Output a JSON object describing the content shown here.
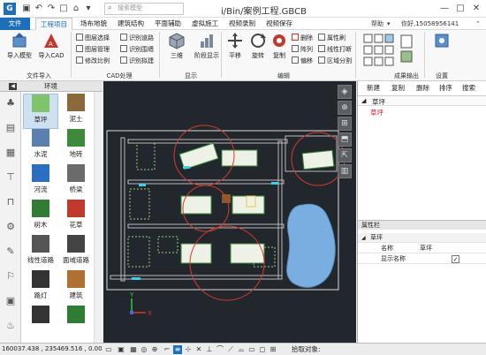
{
  "titlebar": {
    "search_placeholder": "搜索模型",
    "window_title": "i/Bin/案例工程.GBCB",
    "minimize": "—",
    "maximize": "□",
    "close": "✕"
  },
  "menu": {
    "tabs": [
      "文件",
      "工程项目",
      "场布地貌",
      "建筑结构",
      "平面辅助",
      "虚拟施工",
      "视频录制",
      "视频保存"
    ],
    "active_tab": "工程项目",
    "help": "帮助",
    "user": "你好,15058956141"
  },
  "ribbon": {
    "groups": {
      "file_import": "文件导入",
      "cad": "CAD处理",
      "display": "显示",
      "edit": "编辑",
      "output": "成果输出",
      "settings": "设置"
    },
    "import_model": "导入模型",
    "import_cad": "导入CAD",
    "cad_small": [
      "图层选择",
      "图层管理",
      "修改比例"
    ],
    "cad_small2": [
      "识别道路",
      "识别围墙",
      "识别拟建"
    ],
    "three_d": "三维",
    "stage_display": "阶段显示",
    "pan": "平移",
    "rotate": "旋转",
    "copy": "复制",
    "edit_small": [
      "删除",
      "阵列",
      "偏移"
    ],
    "edit_small2": [
      "属性刷",
      "线性打断",
      "区域分割"
    ],
    "accent": "#1e6fb9"
  },
  "leftpanel": {
    "title": "环境",
    "materials": [
      {
        "label": "草坪",
        "color": "#7fc46a"
      },
      {
        "label": "泥土",
        "color": "#8a6a3a"
      },
      {
        "label": "水泥",
        "color": "#5b7fae"
      },
      {
        "label": "地砖",
        "color": "#3c8a3a"
      },
      {
        "label": "河流",
        "color": "#2a6fc0"
      },
      {
        "label": "桥梁",
        "color": "#6b6b6b"
      },
      {
        "label": "树木",
        "color": "#2e7d32"
      },
      {
        "label": "花草",
        "color": "#c0392b"
      },
      {
        "label": "线性道路",
        "color": "#555555"
      },
      {
        "label": "面域道路",
        "color": "#444444"
      },
      {
        "label": "路灯",
        "color": "#333333"
      },
      {
        "label": "建筑",
        "color": "#b07030"
      },
      {
        "label": "",
        "color": "#333333"
      },
      {
        "label": "",
        "color": "#2e7d32"
      }
    ]
  },
  "rightpanel": {
    "buttons": [
      "新建",
      "复制",
      "删除",
      "排序",
      "搜索"
    ],
    "tree_root": "草坪",
    "tree_item": "草坪",
    "props_title": "属性栏",
    "props_group": "草坪",
    "props": [
      {
        "key": "名称",
        "value": "草坪"
      },
      {
        "key": "显示名称",
        "value": "✓"
      }
    ]
  },
  "statusbar": {
    "coords": "160037.438 , 235469.516 , 0.00",
    "pick": "拾取对象:"
  }
}
